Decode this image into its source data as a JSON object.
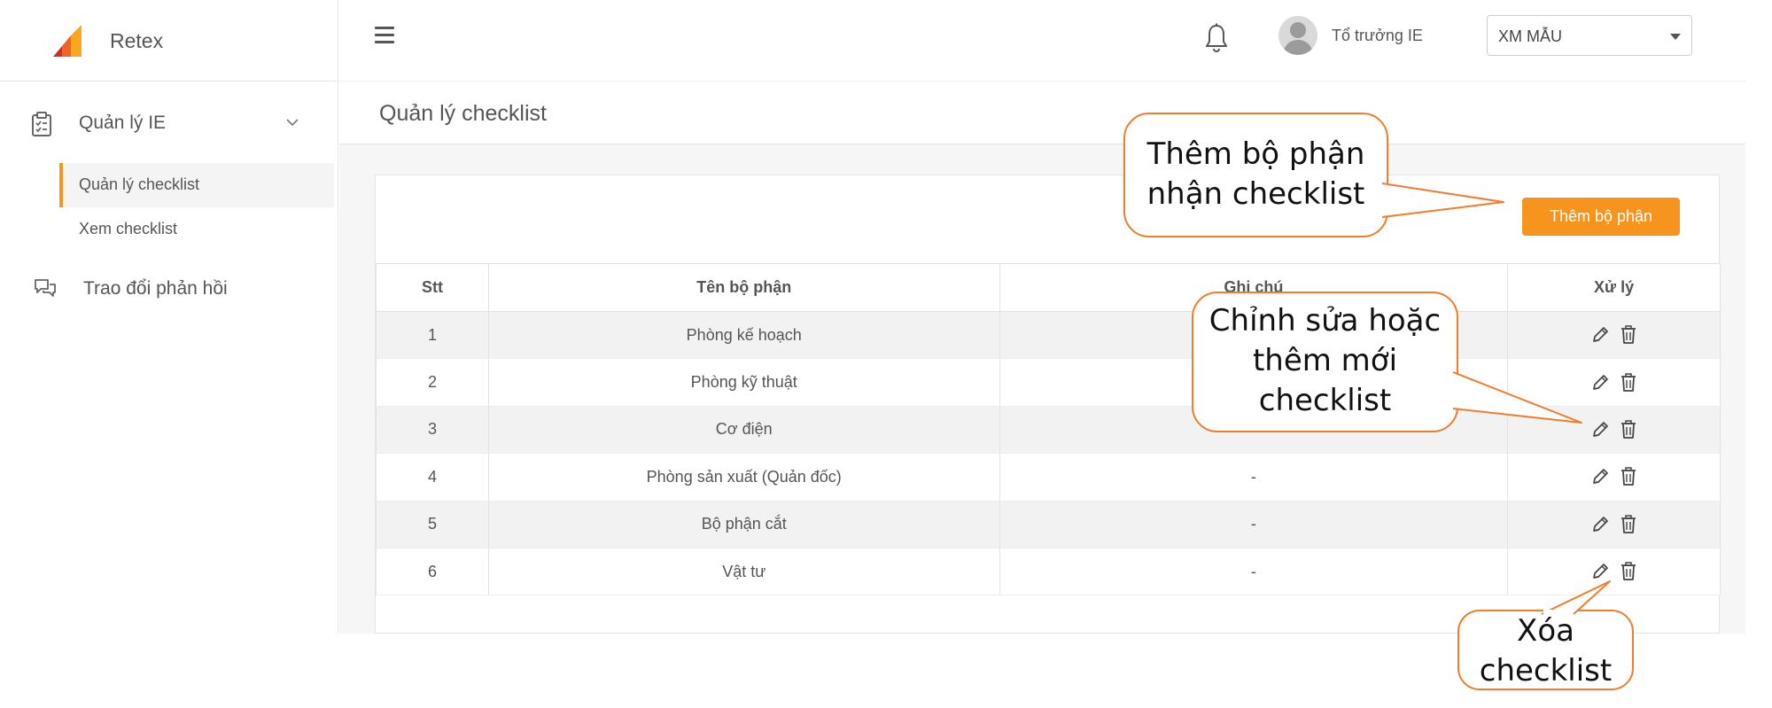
{
  "app": {
    "name": "Retex"
  },
  "sidebar": {
    "group": {
      "label": "Quản lý IE",
      "icon": "clipboard-check-icon"
    },
    "sub_items": [
      {
        "label": "Quản lý checklist",
        "active": true
      },
      {
        "label": "Xem checklist",
        "active": false
      }
    ],
    "feedback": {
      "label": "Trao đổi phản hồi",
      "icon": "chat-bubbles-icon"
    }
  },
  "header": {
    "menu_icon": "hamburger-icon",
    "bell_icon": "bell-icon",
    "user_name": "Tổ trưởng IE",
    "factory": "XM MẪU"
  },
  "page": {
    "title": "Quản lý checklist"
  },
  "toolbar": {
    "add_label": "Thêm bộ phận"
  },
  "table": {
    "headers": {
      "stt": "Stt",
      "name": "Tên bộ phận",
      "note": "Ghi chú",
      "action": "Xử lý"
    },
    "rows": [
      {
        "stt": "1",
        "name": "Phòng kế hoạch",
        "note": ""
      },
      {
        "stt": "2",
        "name": "Phòng kỹ thuật",
        "note": ""
      },
      {
        "stt": "3",
        "name": "Cơ điện",
        "note": ""
      },
      {
        "stt": "4",
        "name": "Phòng sản xuất (Quản đốc)",
        "note": "-"
      },
      {
        "stt": "5",
        "name": "Bộ phận cắt",
        "note": "-"
      },
      {
        "stt": "6",
        "name": "Vật tư",
        "note": "-"
      }
    ]
  },
  "callouts": {
    "add": [
      "Thêm bộ phận",
      "nhận checklist"
    ],
    "edit": [
      "Chỉnh sửa hoặc",
      "thêm mới",
      "checklist"
    ],
    "delete": [
      "Xóa",
      "checklist"
    ]
  },
  "colors": {
    "accent": "#f7941d",
    "callout_border": "#f07d2a"
  }
}
